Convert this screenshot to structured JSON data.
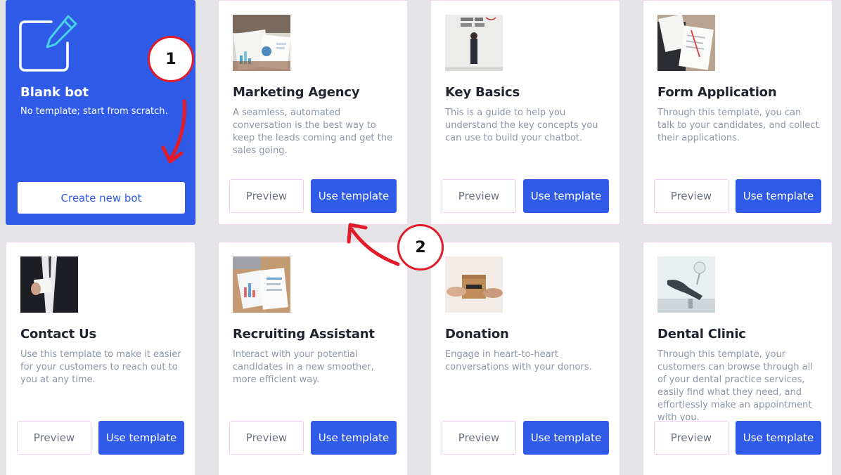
{
  "blank": {
    "title": "Blank bot",
    "subtitle": "No template; start from scratch.",
    "create_label": "Create new bot",
    "icon": "edit-icon"
  },
  "buttons": {
    "preview": "Preview",
    "use_template": "Use template"
  },
  "templates": [
    {
      "title": "Marketing Agency",
      "description": "A seamless, automated conversation is the best way to keep the leads coming and get the sales going.",
      "image": "marketing-charts-photo"
    },
    {
      "title": "Key Basics",
      "description": "This is a guide to help you understand the key concepts you can use to build your chatbot.",
      "image": "man-at-whiteboard-photo"
    },
    {
      "title": "Form Application",
      "description": "Through this template, you can talk to your candidates, and collect their applications.",
      "image": "form-writing-photo"
    },
    {
      "title": "Contact Us",
      "description": "Use this template to make it easier for your customers to reach out to you at any time.",
      "image": "business-card-photo"
    },
    {
      "title": "Recruiting Assistant",
      "description": "Interact with your potential candidates in a new smoother, more efficient way.",
      "image": "documents-desk-photo"
    },
    {
      "title": "Donation",
      "description": "Engage in heart-to-heart conversations with your donors.",
      "image": "donation-box-photo"
    },
    {
      "title": "Dental Clinic",
      "description": "Through this template, your customers can browse through all of your dental practice services, easily find what they need, and effortlessly make an appointment with you.",
      "image": "dental-chair-photo"
    }
  ],
  "annotations": [
    {
      "label": "1"
    },
    {
      "label": "2"
    }
  ],
  "colors": {
    "accent": "#2f5be8",
    "annotation": "#e21b2b"
  }
}
